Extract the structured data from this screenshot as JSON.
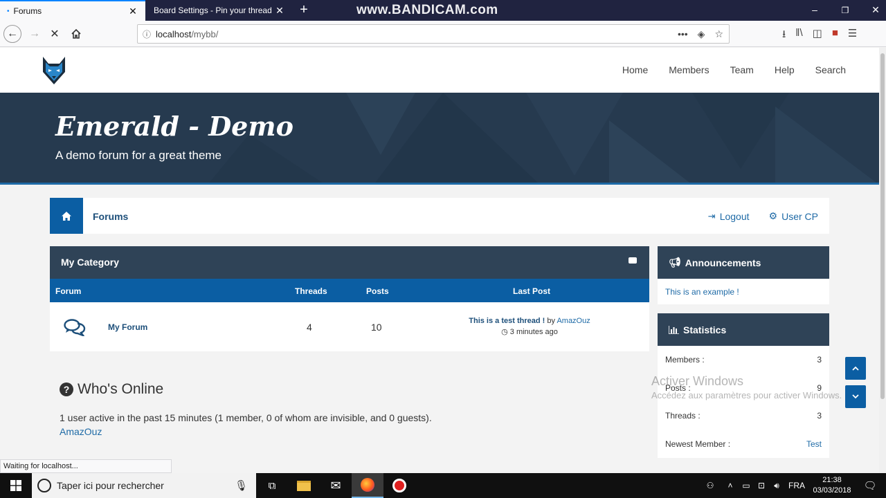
{
  "browser": {
    "tabs": [
      {
        "title": "Forums",
        "active": true
      },
      {
        "title": "Board Settings - Pin your thread",
        "active": false
      }
    ],
    "watermark": "www.BANDICAM.com",
    "url_host": "localhost",
    "url_path": "/mybb/",
    "status_text": "Waiting for localhost..."
  },
  "site": {
    "nav": [
      "Home",
      "Members",
      "Team",
      "Help",
      "Search"
    ],
    "banner_title": "Emerald - Demo",
    "banner_subtitle": "A demo forum for a great theme",
    "breadcrumb_label": "Forums",
    "logout_label": "Logout",
    "usercp_label": "User CP"
  },
  "category": {
    "title": "My Category",
    "columns": {
      "forum": "Forum",
      "threads": "Threads",
      "posts": "Posts",
      "last_post": "Last Post"
    },
    "rows": [
      {
        "forum": "My Forum",
        "threads": "4",
        "posts": "10",
        "last_post_title": "This is a test thread !",
        "last_post_by": "by",
        "last_post_user": "AmazOuz",
        "last_post_time": "3 minutes ago"
      }
    ]
  },
  "whos_online": {
    "title": "Who's Online",
    "text": "1 user active in the past 15 minutes (1 member, 0 of whom are invisible, and 0 guests).",
    "users": "AmazOuz"
  },
  "announcements": {
    "title": "Announcements",
    "text": "This is an example !"
  },
  "statistics": {
    "title": "Statistics",
    "rows": [
      {
        "label": "Members :",
        "value": "3"
      },
      {
        "label": "Posts :",
        "value": "9"
      },
      {
        "label": "Threads :",
        "value": "3"
      },
      {
        "label": "Newest Member :",
        "value": "Test"
      }
    ]
  },
  "overlay": {
    "activate_title": "Activer Windows",
    "activate_sub": "Accédez aux paramètres pour activer Windows."
  },
  "taskbar": {
    "search_placeholder": "Taper ici pour rechercher",
    "language": "FRA",
    "time": "21:38",
    "date": "03/03/2018"
  },
  "colors": {
    "primary_blue": "#0b5ea3",
    "dark_header": "#2f4357",
    "banner": "#263a4f"
  }
}
